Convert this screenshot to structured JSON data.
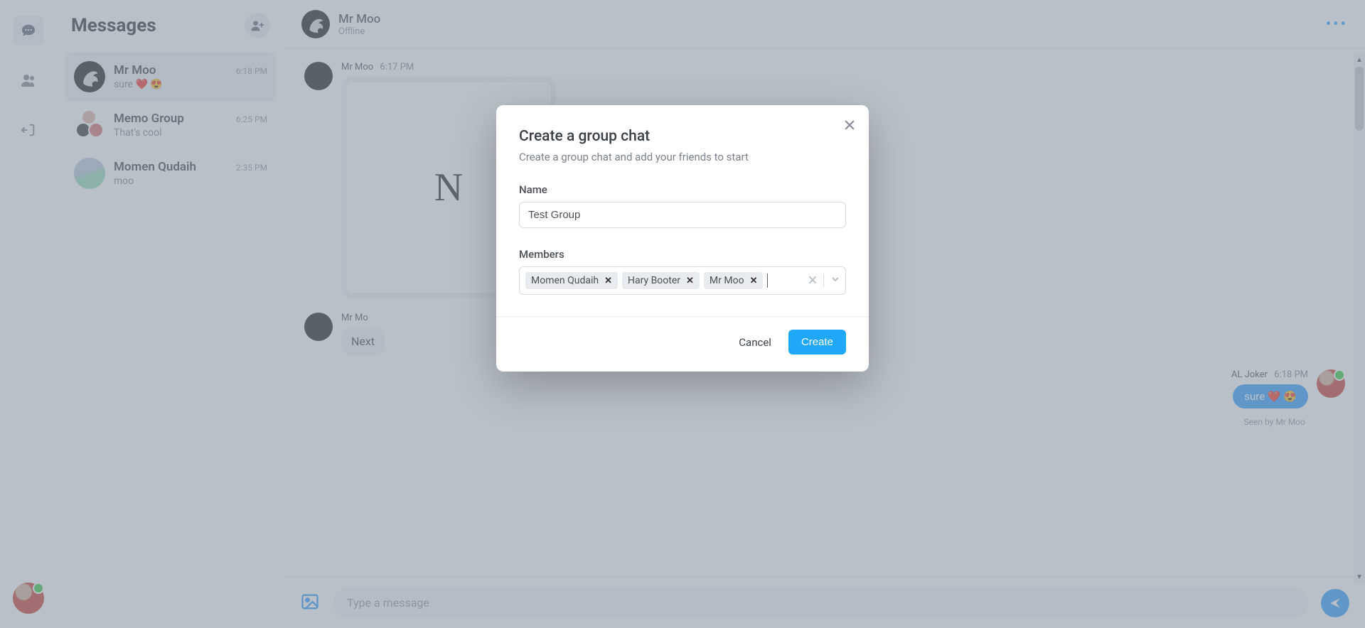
{
  "rail": {
    "items": [
      "messages-icon",
      "friends-icon",
      "logout-icon"
    ]
  },
  "sidebar": {
    "title": "Messages",
    "conversations": [
      {
        "name": "Mr Moo",
        "preview": "sure ❤️ 😍",
        "time": "6:18 PM"
      },
      {
        "name": "Memo Group",
        "preview": "That's cool",
        "time": "6:25 PM"
      },
      {
        "name": "Momen Qudaih",
        "preview": "moo",
        "time": "2:35 PM"
      }
    ]
  },
  "chat": {
    "header": {
      "name": "Mr Moo",
      "status": "Offline"
    },
    "messages": {
      "first_meta_name": "Mr Moo",
      "first_meta_time": "6:17 PM",
      "img_letter": "N",
      "second_meta_name": "Mr Mo",
      "second_bubble": "Next",
      "right_meta_name": "AL Joker",
      "right_meta_time": "6:18 PM",
      "right_bubble": "sure ❤️ 😍",
      "seen": "Seen by Mr Moo"
    },
    "input_placeholder": "Type a message"
  },
  "modal": {
    "title": "Create a group chat",
    "subtitle": "Create a group chat and add your friends to start",
    "name_label": "Name",
    "name_value": "Test Group",
    "members_label": "Members",
    "members": [
      "Momen Qudaih",
      "Hary Booter",
      "Mr Moo"
    ],
    "cancel": "Cancel",
    "create": "Create"
  }
}
